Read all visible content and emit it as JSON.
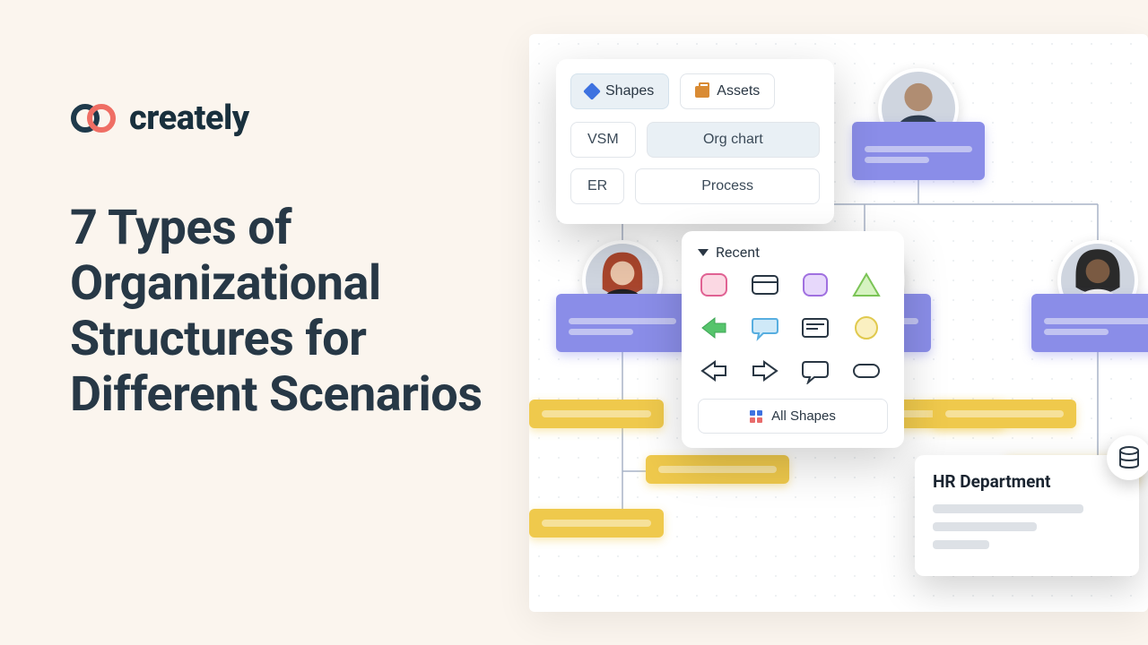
{
  "brand": {
    "name": "creately"
  },
  "headline": "7 Types of Organizational Structures for Different Scenarios",
  "popover": {
    "tabs": {
      "shapes": "Shapes",
      "assets": "Assets"
    },
    "chips": {
      "vsm": "VSM",
      "orgchart": "Org chart",
      "er": "ER",
      "process": "Process"
    }
  },
  "recent": {
    "title": "Recent",
    "all_shapes": "All Shapes"
  },
  "hr_card": {
    "title": "HR Department"
  },
  "colors": {
    "purple": "#8a8de8",
    "yellow": "#efc94c",
    "navy": "#273846"
  }
}
